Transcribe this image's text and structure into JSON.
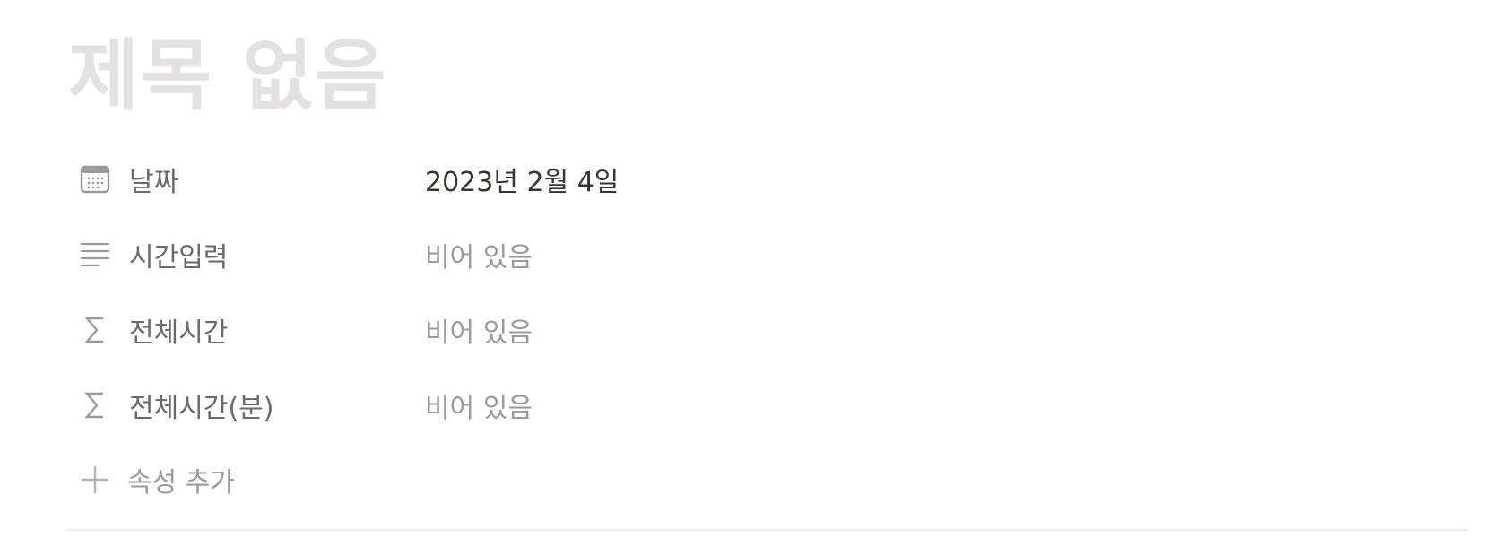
{
  "page": {
    "title_placeholder": "제목 없음"
  },
  "properties": [
    {
      "icon": "calendar-icon",
      "label": "날짜",
      "value": "2023년 2월 4일",
      "empty": false
    },
    {
      "icon": "text-lines-icon",
      "label": "시간입력",
      "value": "비어 있음",
      "empty": true
    },
    {
      "icon": "sigma-icon",
      "label": "전체시간",
      "value": "비어 있음",
      "empty": true
    },
    {
      "icon": "sigma-icon",
      "label": "전체시간(분)",
      "value": "비어 있음",
      "empty": true
    }
  ],
  "add_property": {
    "icon": "plus-icon",
    "label": "속성 추가"
  },
  "colors": {
    "title_placeholder": "#e3e2e0",
    "label": "#6b6a66",
    "value": "#37352f",
    "empty_value": "#9b9a97",
    "divider": "#ebebea"
  }
}
